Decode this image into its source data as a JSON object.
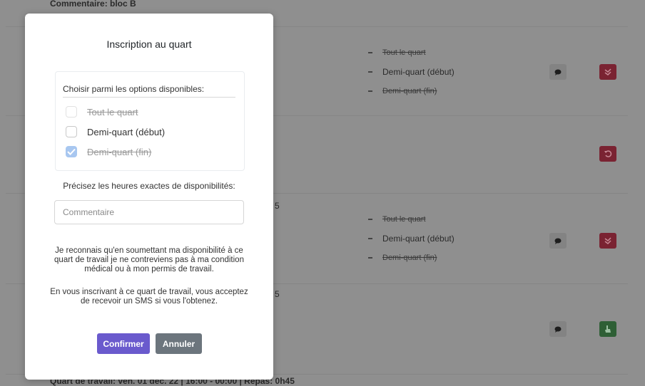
{
  "background": {
    "top_partial_text": "Commentaire: bloc B",
    "bottom_partial_text": "Quart de travail: ven. 01 déc. 22 | 16:00 - 00:00 | Repas: 0h45",
    "digit_a": "5",
    "digit_b": "5",
    "options": [
      "Tout le quart",
      "Demi-quart (début)",
      "Demi-quart (fin)"
    ]
  },
  "modal": {
    "title": "Inscription au quart",
    "options_header": "Choisir parmi les options disponibles:",
    "options": [
      {
        "label": "Tout le quart",
        "disabled": true,
        "checked": false
      },
      {
        "label": "Demi-quart (début)",
        "disabled": false,
        "checked": false
      },
      {
        "label": "Demi-quart (fin)",
        "disabled": true,
        "checked": true
      }
    ],
    "hours_prompt": "Précisez les heures exactes de disponibilités:",
    "comment_placeholder": "Commentaire",
    "disclaimer_1": "Je reconnais qu'en soumettant ma disponibilité à ce quart de travail je ne contreviens pas à ma condition médical ou à mon permis de travail.",
    "disclaimer_2": "En vous inscrivant à ce quart de travail, vous acceptez de recevoir un SMS si vous l'obtenez.",
    "confirm_label": "Confirmer",
    "cancel_label": "Annuler"
  },
  "colors": {
    "confirm": "#6a5acd",
    "cancel": "#6c757d",
    "red_action": "#dc3545",
    "green_action": "#28a745"
  },
  "icons": [
    "chat-icon",
    "double-check-icon",
    "undo-icon",
    "hand-pointer-icon"
  ]
}
